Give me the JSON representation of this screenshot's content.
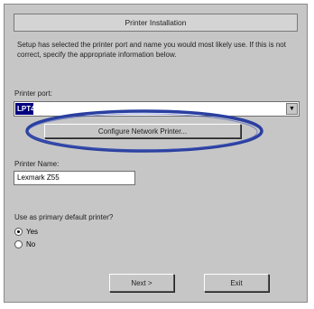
{
  "dialog": {
    "title": "Printer Installation",
    "description": "Setup has selected the printer port and name you would most likely use. If this is not correct, specify the appropriate information below."
  },
  "port": {
    "label": "Printer port:",
    "value": "LPT4",
    "dropdown_icon": "chevron-down-icon"
  },
  "configure_button": {
    "label": "Configure Network Printer..."
  },
  "printer_name": {
    "label": "Printer Name:",
    "value": "Lexmark Z55"
  },
  "default_printer": {
    "question": "Use as primary default printer?",
    "options": [
      {
        "label": "Yes",
        "selected": true
      },
      {
        "label": "No",
        "selected": false
      }
    ]
  },
  "buttons": {
    "next_label": "Next >",
    "exit_label": "Exit"
  },
  "colors": {
    "dialog_bg": "#c6c6c6",
    "selection": "#000080",
    "highlight_ellipse": "#2a3fa0"
  }
}
